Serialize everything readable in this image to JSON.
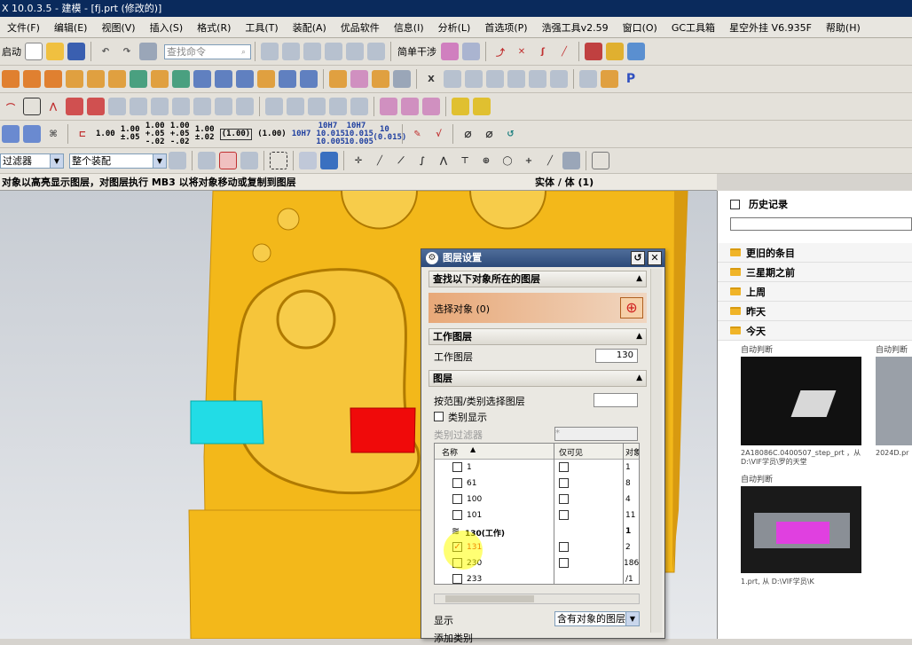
{
  "window": {
    "title": "X 10.0.3.5 - 建模 - [fj.prt (修改的)]"
  },
  "menus": [
    "文件(F)",
    "编辑(E)",
    "视图(V)",
    "插入(S)",
    "格式(R)",
    "工具(T)",
    "装配(A)",
    "优品软件",
    "信息(I)",
    "分析(L)",
    "首选项(P)",
    "浩强工具v2.59",
    "窗口(O)",
    "GC工具箱",
    "星空外挂 V6.935F",
    "帮助(H)"
  ],
  "toolbar": {
    "start_label": "启动",
    "search_placeholder": "查找命令",
    "simple_interference": "简单干涉",
    "tolerance_btns": [
      "1.00",
      "1.00 ±.05",
      "1.00 +.05 -.02",
      "1.00 +.05 -.02",
      "1.00 ±.02",
      "(1.00)",
      "(1.00)",
      "10H7",
      "10H7 10.015 10.005",
      "10H7 10.015 10.005",
      "10 (0.015)"
    ],
    "filter_left": "过滤器",
    "filter_assembly": "整个装配"
  },
  "cue": {
    "text": "对象以高亮显示图层，对图层执行 MB3 以将对象移动或复制到图层",
    "status": "实体 / 体 (1)"
  },
  "history": {
    "title": "历史记录",
    "groups": [
      "更旧的条目",
      "三星期之前",
      "上周",
      "昨天",
      "今天"
    ],
    "thumbs": [
      {
        "label": "自动判断",
        "caption": "2A18086C.0400507_step_prt ，从 D:\\VIF学员\\罗的天堂"
      },
      {
        "label": "自动判断",
        "caption": "2024D.pr"
      },
      {
        "label": "自动判断",
        "caption": "1.prt, 从 D:\\VIF学员\\K"
      }
    ]
  },
  "dialog": {
    "title": "图层设置",
    "sec_find": "查找以下对象所在的图层",
    "select_object": "选择对象 (0)",
    "sec_work": "工作图层",
    "work_label": "工作图层",
    "work_value": "130",
    "sec_layers": "图层",
    "select_by_range": "按范围/类别选择图层",
    "category_display": "类别显示",
    "category_filter": "类别过滤器",
    "category_filter_value": "*",
    "col_name": "名称",
    "col_visible": "仅可见",
    "col_count": "对象数",
    "rows": [
      {
        "name": "1",
        "count": "1"
      },
      {
        "name": "61",
        "count": "8"
      },
      {
        "name": "100",
        "count": "4"
      },
      {
        "name": "101",
        "count": "11"
      },
      {
        "name": "130(工作)",
        "count": "1"
      },
      {
        "name": "131",
        "count": "2"
      },
      {
        "name": "230",
        "count": "186"
      },
      {
        "name": "233",
        "count": "/1"
      }
    ],
    "display_label": "显示",
    "display_value": "含有对象的图层",
    "add_label": "添加类别"
  }
}
